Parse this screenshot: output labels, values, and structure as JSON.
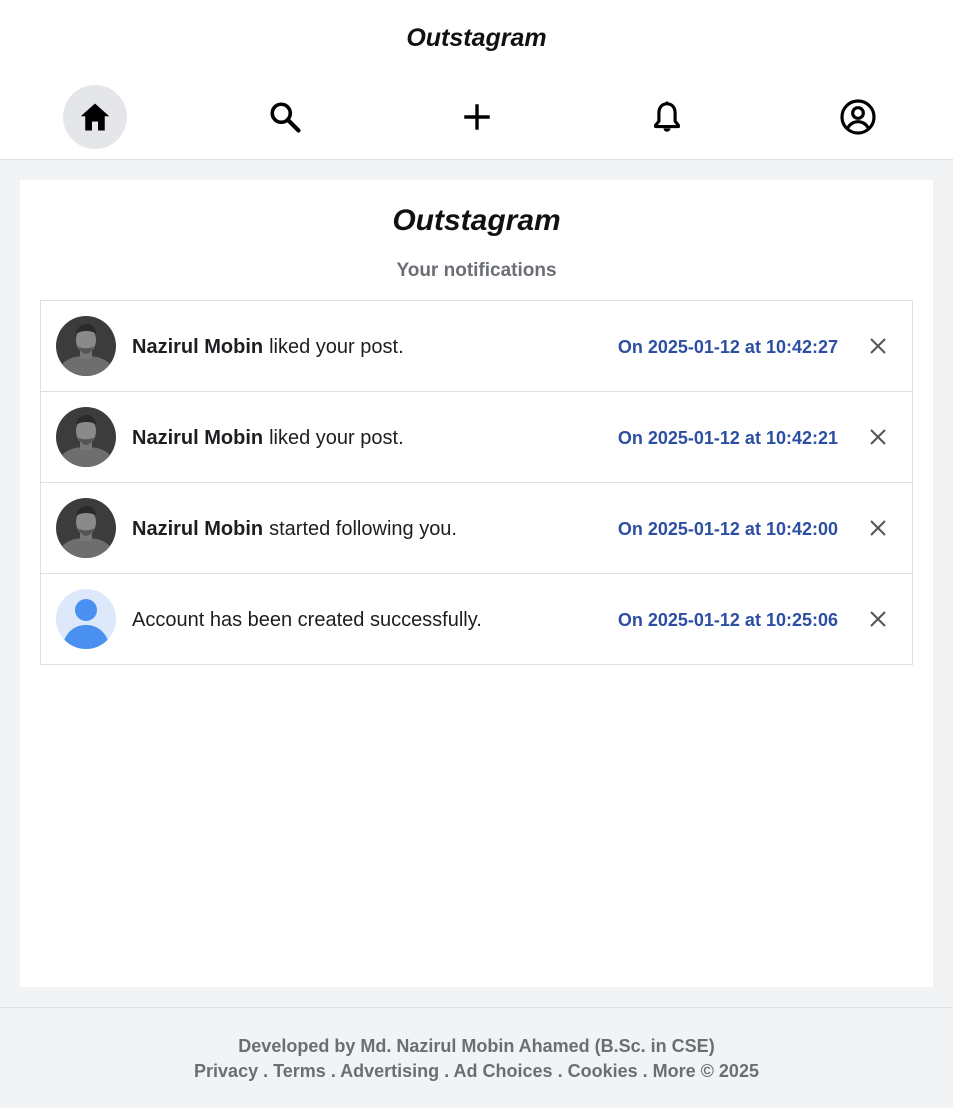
{
  "header": {
    "brand": "Outstagram",
    "nav": [
      {
        "name": "home",
        "icon": "home-icon",
        "active": true
      },
      {
        "name": "search",
        "icon": "search-icon",
        "active": false
      },
      {
        "name": "create",
        "icon": "plus-icon",
        "active": false
      },
      {
        "name": "notifications",
        "icon": "bell-icon",
        "active": false
      },
      {
        "name": "profile",
        "icon": "user-circle-icon",
        "active": false
      }
    ]
  },
  "main": {
    "title": "Outstagram",
    "subtitle": "Your notifications",
    "notifications": [
      {
        "user": "Nazirul Mobin",
        "message": "liked your post.",
        "time": "On 2025-01-12 at 10:42:27",
        "avatar": "user-photo"
      },
      {
        "user": "Nazirul Mobin",
        "message": "liked your post.",
        "time": "On 2025-01-12 at 10:42:21",
        "avatar": "user-photo"
      },
      {
        "user": "Nazirul Mobin",
        "message": "started following you.",
        "time": "On 2025-01-12 at 10:42:00",
        "avatar": "user-photo"
      },
      {
        "user": "",
        "message": "Account has been created successfully.",
        "time": "On 2025-01-12 at 10:25:06",
        "avatar": "default-avatar"
      }
    ]
  },
  "footer": {
    "developer": "Developed by Md. Nazirul Mobin Ahamed (B.Sc. in CSE)",
    "links": [
      "Privacy",
      "Terms",
      "Advertising",
      "Ad Choices",
      "Cookies",
      "More"
    ],
    "separator": " . ",
    "copyright": "© 2025"
  },
  "colors": {
    "timestamp": "#2d4fa3",
    "muted": "#6b6f75",
    "default_avatar_bg": "#dde8fb",
    "default_avatar_fg": "#4a90f0"
  }
}
